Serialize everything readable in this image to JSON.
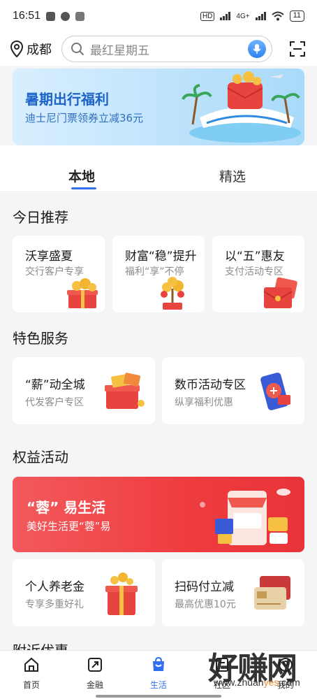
{
  "status_bar": {
    "time": "16:51",
    "network_label": "HD",
    "network_type": "4G+",
    "battery": "11"
  },
  "header": {
    "city": "成都",
    "search_placeholder": "最红星期五"
  },
  "banner": {
    "title": "暑期出行福利",
    "subtitle": "迪士尼门票领券立减36元"
  },
  "tabs": [
    {
      "label": "本地",
      "active": true
    },
    {
      "label": "精选",
      "active": false
    }
  ],
  "today_section": {
    "title": "今日推荐",
    "cards": [
      {
        "title": "沃享盛夏",
        "subtitle": "交行客户专享"
      },
      {
        "title": "财富“稳”提升",
        "subtitle": "福利“享”不停"
      },
      {
        "title": "以“五”惠友",
        "subtitle": "支付活动专区"
      }
    ]
  },
  "feature_section": {
    "title": "特色服务",
    "cards": [
      {
        "title": "“薪”动全城",
        "subtitle": "代发客户专区"
      },
      {
        "title": "数币活动专区",
        "subtitle": "纵享福利优惠"
      }
    ]
  },
  "rights_section": {
    "title": "权益活动",
    "promo_title": "“蓉” 易生活",
    "promo_subtitle": "美好生活更“蓉”易",
    "cards": [
      {
        "title": "个人养老金",
        "subtitle": "专享多重好礼"
      },
      {
        "title": "扫码付立减",
        "subtitle": "最高优惠10元"
      }
    ]
  },
  "nearby_section": {
    "title": "附近优惠"
  },
  "bottom_nav": [
    {
      "label": "首页",
      "icon": "home-icon"
    },
    {
      "label": "金融",
      "icon": "finance-icon"
    },
    {
      "label": "生活",
      "icon": "life-icon"
    },
    {
      "label": "社区",
      "icon": "community-icon"
    },
    {
      "label": "我的",
      "icon": "profile-icon"
    }
  ],
  "watermark": {
    "title": "好赚网",
    "url_prefix": "www.zhuan",
    "url_highlight": "yes",
    "url_suffix": ".com"
  },
  "colors": {
    "accent_blue": "#2f6ff0",
    "promo_red": "#ef3c3f",
    "page_bg": "#f4f5f7"
  }
}
